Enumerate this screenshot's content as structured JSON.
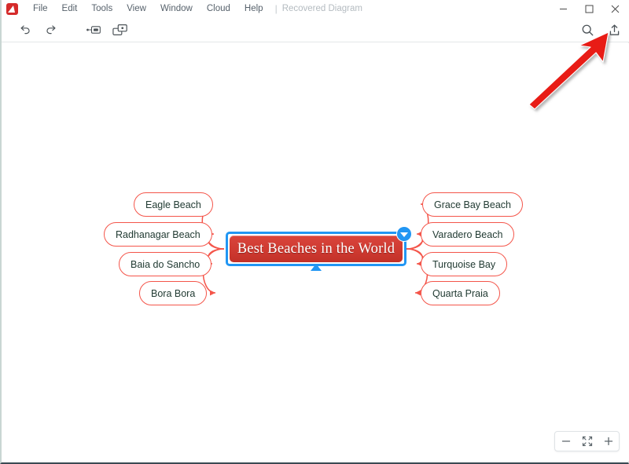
{
  "window": {
    "app_icon": "app-logo-icon",
    "document_title": "Recovered Diagram",
    "title_separator": "|",
    "controls": {
      "minimize": "minimize-icon",
      "maximize": "maximize-icon",
      "close": "close-icon"
    }
  },
  "menubar": {
    "items": [
      {
        "label": "File"
      },
      {
        "label": "Edit"
      },
      {
        "label": "Tools"
      },
      {
        "label": "View"
      },
      {
        "label": "Window"
      },
      {
        "label": "Cloud"
      },
      {
        "label": "Help"
      }
    ]
  },
  "toolbar": {
    "buttons": [
      {
        "name": "undo-button",
        "icon": "undo-arrow-icon"
      },
      {
        "name": "redo-button",
        "icon": "redo-arrow-icon"
      },
      {
        "name": "insert-topic-button",
        "icon": "insert-topic-icon"
      },
      {
        "name": "insert-subtopic-button",
        "icon": "insert-subtopic-icon"
      }
    ],
    "right_buttons": [
      {
        "name": "search-button",
        "icon": "search-icon"
      },
      {
        "name": "share-export-button",
        "icon": "share-upload-icon"
      }
    ]
  },
  "mindmap": {
    "central_topic": {
      "label": "Best Beaches in the World",
      "selected": true,
      "fill_color": "#cf3a31",
      "selection_color": "#2196f3",
      "text_color": "#ffffff",
      "collapse_toggle": "collapse-chevron-icon"
    },
    "node_style": {
      "border_color": "#f4554a",
      "fill_color": "#ffffff",
      "text_color": "#223b33",
      "link_color": "#f4554a"
    },
    "left_topics": [
      {
        "label": "Eagle Beach"
      },
      {
        "label": "Radhanagar Beach"
      },
      {
        "label": "Baia do Sancho"
      },
      {
        "label": "Bora Bora"
      }
    ],
    "right_topics": [
      {
        "label": "Grace Bay Beach"
      },
      {
        "label": "Varadero Beach"
      },
      {
        "label": "Turquoise Bay"
      },
      {
        "label": "Quarta Praia"
      }
    ]
  },
  "annotation": {
    "type": "arrow",
    "color": "#e81b14",
    "points_to": "share-export-button"
  },
  "zoom_controls": {
    "zoom_out": "minus-icon",
    "fit_to_screen": "fit-screen-icon",
    "zoom_in": "plus-icon"
  }
}
